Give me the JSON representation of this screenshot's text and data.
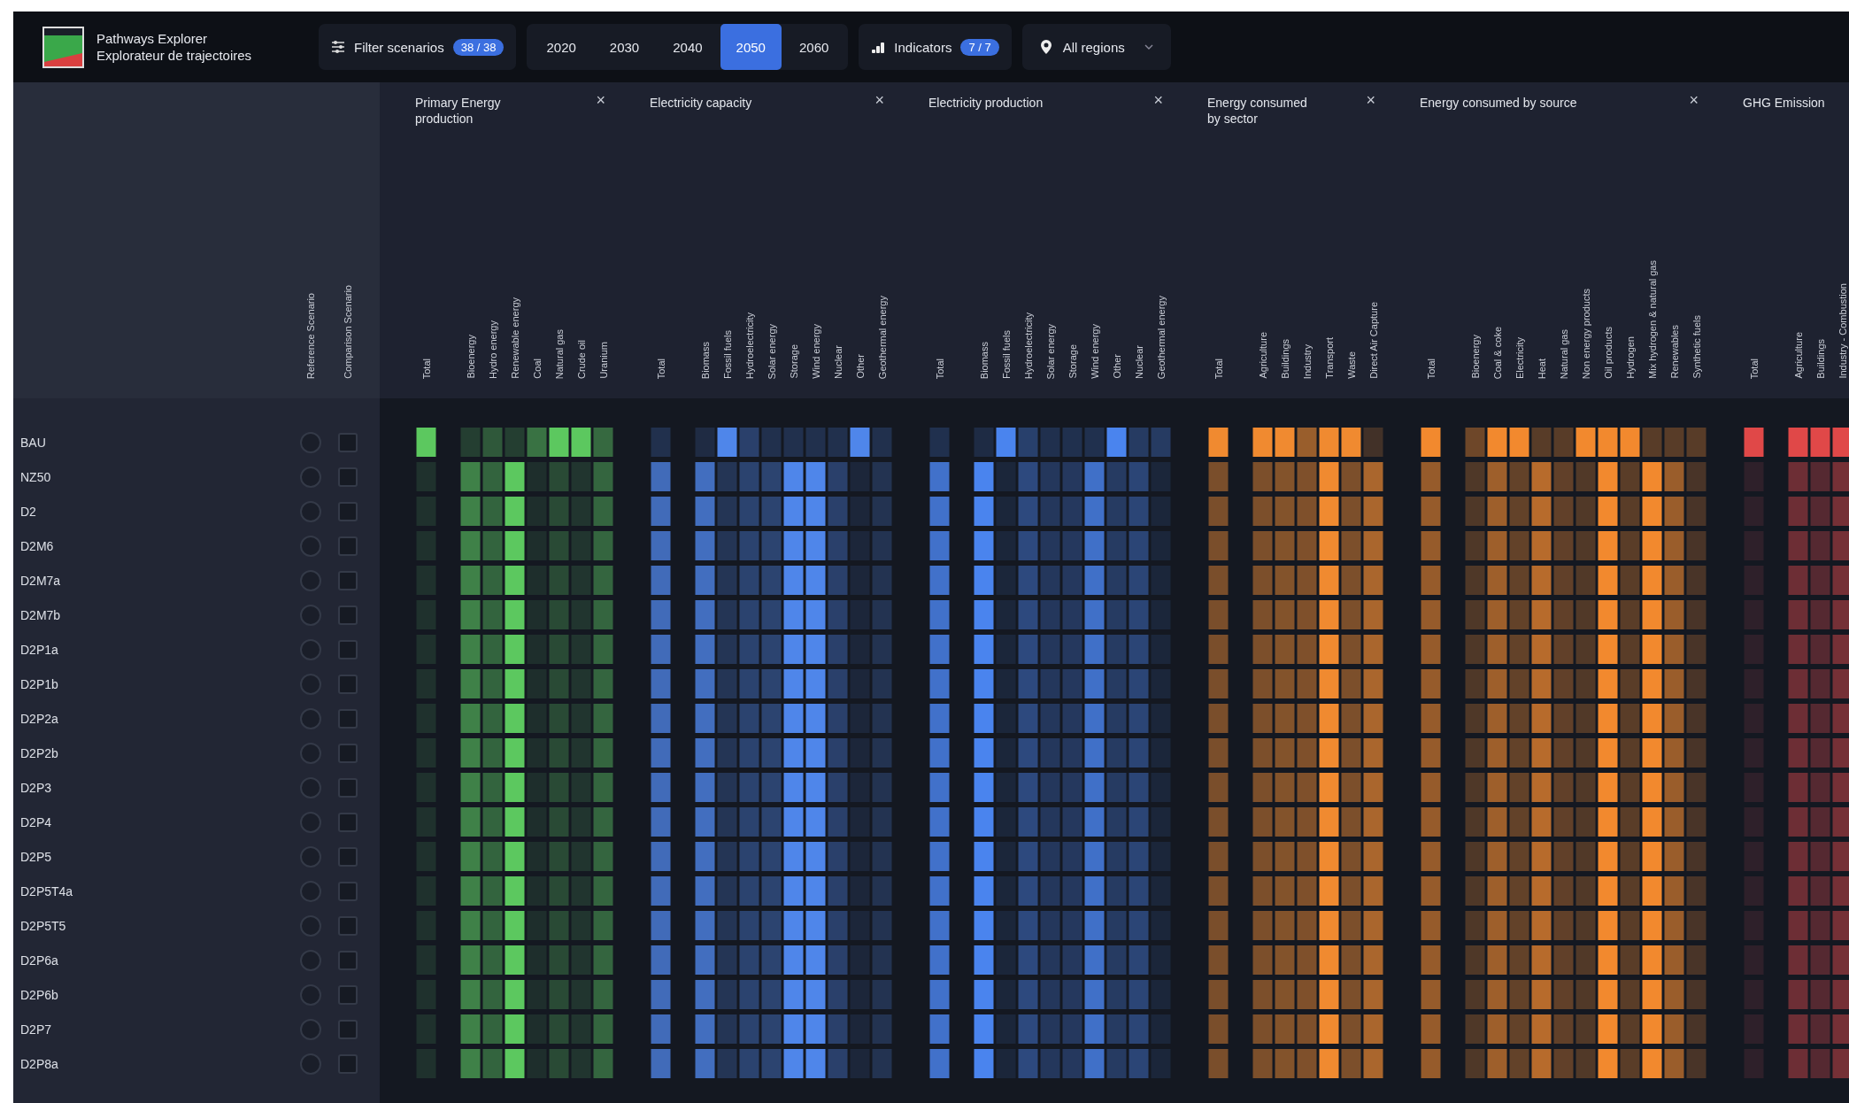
{
  "app": {
    "title": "Pathways Explorer",
    "subtitle": "Explorateur de trajectoires"
  },
  "toolbar": {
    "filter": {
      "label": "Filter scenarios",
      "count": "38 / 38"
    },
    "years": [
      {
        "label": "2020",
        "selected": false
      },
      {
        "label": "2030",
        "selected": false
      },
      {
        "label": "2040",
        "selected": false
      },
      {
        "label": "2050",
        "selected": true
      },
      {
        "label": "2060",
        "selected": false
      }
    ],
    "indicators": {
      "label": "Indicators",
      "count": "7 / 7"
    },
    "region": {
      "label": "All regions"
    }
  },
  "scenario_columns": [
    "Reference Scenario",
    "Comparison Scenario"
  ],
  "indicator_groups": [
    {
      "title": "Primary Energy production",
      "close": "×",
      "color": "#5cc85f",
      "columns": [
        "Total",
        "Bioenergy",
        "Hydro energy",
        "Renewable energy",
        "Coal",
        "Natural gas",
        "Crude oil",
        "Uranium"
      ]
    },
    {
      "title": "Electricity capacity",
      "close": "×",
      "color": "#4f86ea",
      "columns": [
        "Total",
        "Biomass",
        "Fossil fuels",
        "Hydroelectricity",
        "Solar energy",
        "Storage",
        "Wind energy",
        "Nuclear",
        "Other",
        "Geothermal energy"
      ]
    },
    {
      "title": "Electricity production",
      "close": "×",
      "color": "#4a84ee",
      "columns": [
        "Total",
        "Biomass",
        "Fossil fuels",
        "Hydroelectricity",
        "Solar energy",
        "Storage",
        "Wind energy",
        "Other",
        "Nuclear",
        "Geothermal energy"
      ]
    },
    {
      "title": "Energy consumed by sector",
      "close": "×",
      "color": "#f08a30",
      "columns": [
        "Total",
        "Agriculture",
        "Buildings",
        "Industry",
        "Transport",
        "Waste",
        "Direct Air Capture"
      ]
    },
    {
      "title": "Energy consumed by source",
      "close": "×",
      "color": "#f2892e",
      "columns": [
        "Total",
        "Bioenergy",
        "Coal & coke",
        "Electricity",
        "Heat",
        "Natural gas",
        "Non energy products",
        "Oil products",
        "Hydrogen",
        "Mix hydrogen & natural gas",
        "Renewables",
        "Synthetic fuels"
      ]
    },
    {
      "title": "GHG Emission",
      "color": "#e04848",
      "columns": [
        "Total",
        "Agriculture",
        "Buildings",
        "Industry - Combustion"
      ]
    }
  ],
  "scenarios": [
    {
      "name": "BAU",
      "reference": false,
      "comparison": false
    },
    {
      "name": "NZ50",
      "reference": false,
      "comparison": false
    },
    {
      "name": "D2",
      "reference": false,
      "comparison": false
    },
    {
      "name": "D2M6",
      "reference": false,
      "comparison": false
    },
    {
      "name": "D2M7a",
      "reference": false,
      "comparison": false
    },
    {
      "name": "D2M7b",
      "reference": false,
      "comparison": false
    },
    {
      "name": "D2P1a",
      "reference": false,
      "comparison": false
    },
    {
      "name": "D2P1b",
      "reference": false,
      "comparison": false
    },
    {
      "name": "D2P2a",
      "reference": false,
      "comparison": false
    },
    {
      "name": "D2P2b",
      "reference": false,
      "comparison": false
    },
    {
      "name": "D2P3",
      "reference": false,
      "comparison": false
    },
    {
      "name": "D2P4",
      "reference": false,
      "comparison": false
    },
    {
      "name": "D2P5",
      "reference": false,
      "comparison": false
    },
    {
      "name": "D2P5T4a",
      "reference": false,
      "comparison": false
    },
    {
      "name": "D2P5T5",
      "reference": false,
      "comparison": false
    },
    {
      "name": "D2P6a",
      "reference": false,
      "comparison": false
    },
    {
      "name": "D2P6b",
      "reference": false,
      "comparison": false
    },
    {
      "name": "D2P7",
      "reference": false,
      "comparison": false
    },
    {
      "name": "D2P8a",
      "reference": false,
      "comparison": false
    }
  ]
}
